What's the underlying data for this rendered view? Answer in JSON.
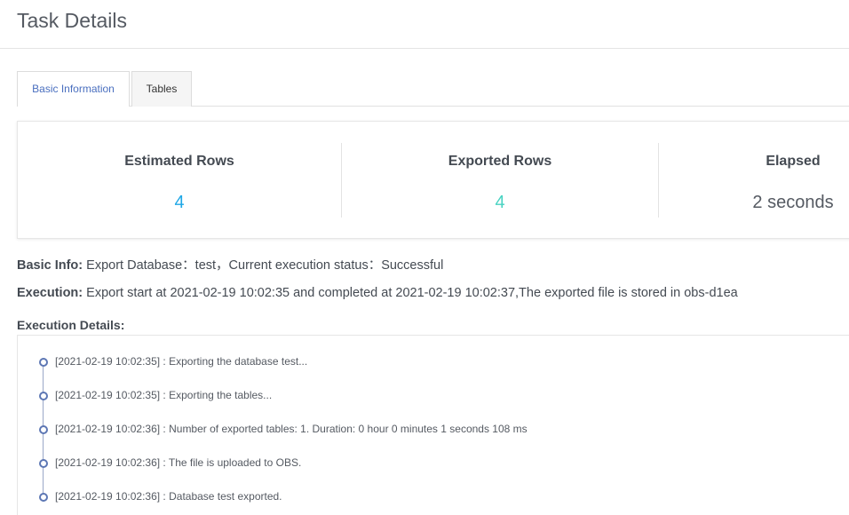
{
  "header": {
    "title": "Task Details"
  },
  "tabs": [
    {
      "label": "Basic Information",
      "active": true
    },
    {
      "label": "Tables",
      "active": false
    }
  ],
  "stats": {
    "estimated": {
      "label": "Estimated Rows",
      "value": "4",
      "color": "#1fa7e6"
    },
    "exported": {
      "label": "Exported Rows",
      "value": "4",
      "color": "#49d3c2"
    },
    "elapsed": {
      "label": "Elapsed",
      "value": "2 seconds",
      "color": "#555a62"
    }
  },
  "basic_info": {
    "label": "Basic Info:",
    "text": "Export Database：test，Current execution status：Successful"
  },
  "execution": {
    "label": "Execution:",
    "text": "Export start at 2021-02-19 10:02:35 and completed at 2021-02-19 10:02:37,The exported file is stored in obs-d1ea"
  },
  "execution_details": {
    "title": "Execution Details:",
    "items": [
      "[2021-02-19 10:02:35] : Exporting the database test...",
      "[2021-02-19 10:02:35] : Exporting the tables...",
      "[2021-02-19 10:02:36] : Number of exported tables: 1. Duration: 0 hour 0 minutes 1 seconds 108 ms",
      "[2021-02-19 10:02:36] : The file is uploaded to OBS.",
      "[2021-02-19 10:02:36] : Database test exported."
    ]
  }
}
